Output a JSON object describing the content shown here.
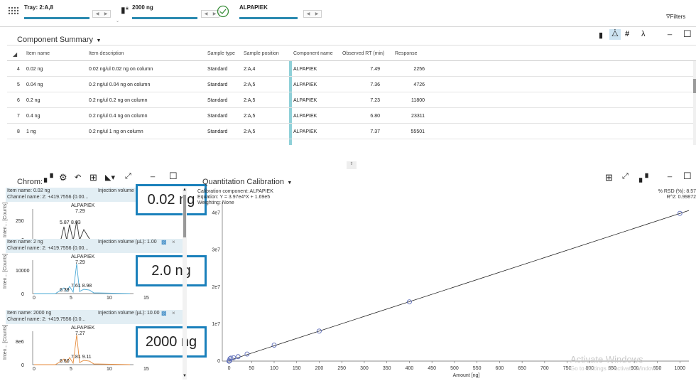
{
  "topbar": {
    "tray_label": "Tray: 2:A,8",
    "amount_label": "2000 ng",
    "component_label": "ALPAPIEK",
    "filters_label": "Filters"
  },
  "component_summary": {
    "title": "Component Summary",
    "columns": [
      "Item name",
      "Item description",
      "Sample type",
      "Sample position",
      "Component name",
      "Observed RT (min)",
      "Response"
    ],
    "rows": [
      {
        "idx": "4",
        "name": "0.02 ng",
        "desc": "0.02 ng/ul 0.02 ng on column",
        "type": "Standard",
        "pos": "2:A,4",
        "comp": "ALPAPIEK",
        "rt": "7.49",
        "resp": "2256"
      },
      {
        "idx": "5",
        "name": "0.04 ng",
        "desc": "0.2 ng/ul 0.04 ng on column",
        "type": "Standard",
        "pos": "2:A,5",
        "comp": "ALPAPIEK",
        "rt": "7.36",
        "resp": "4726"
      },
      {
        "idx": "6",
        "name": "0.2 ng",
        "desc": "0.2 ng/ul 0.2 ng on column",
        "type": "Standard",
        "pos": "2:A,5",
        "comp": "ALPAPIEK",
        "rt": "7.23",
        "resp": "11800"
      },
      {
        "idx": "7",
        "name": "0.4 ng",
        "desc": "0.2 ng/ul 0.4 ng on column",
        "type": "Standard",
        "pos": "2:A,5",
        "comp": "ALPAPIEK",
        "rt": "6.80",
        "resp": "23311"
      },
      {
        "idx": "8",
        "name": "1 ng",
        "desc": "0.2 ng/ul 1 ng on column",
        "type": "Standard",
        "pos": "2:A,5",
        "comp": "ALPAPIEK",
        "rt": "7.37",
        "resp": "55501"
      }
    ]
  },
  "chromatograms": {
    "title": "Chrom:",
    "ylabel": "Inten... [Counts]",
    "panels": [
      {
        "item": "Item name: 0.02 ng",
        "inj": "Injection volume (µL): 1.00",
        "channel": "Channel name: 2: +419.7556 (0.00...",
        "peak": "ALPAPIEK",
        "peak_rt": "7.29",
        "extra1": "5.87",
        "extra2": "8.03",
        "ytick": "250",
        "ytick0": "0",
        "xticks": [
          "0",
          "5",
          "10",
          "15"
        ],
        "badge": "0.02 ng",
        "color": "#333333"
      },
      {
        "item": "Item name: 2 ng",
        "inj": "Injection volume (µL): 1.00",
        "channel": "Channel name: 2: +419.7556 (0.00...",
        "peak": "ALPAPIEK",
        "peak_rt": "7.29",
        "extra1": "6.39",
        "extra2": "7.61 8.98",
        "ytick": "10000",
        "ytick0": "0",
        "xticks": [
          "0",
          "5",
          "10",
          "15"
        ],
        "badge": "2.0 ng",
        "color": "#4aa9d6"
      },
      {
        "item": "Item name: 2000 ng",
        "inj": "Injection volume (µL): 10.00",
        "channel": "Channel name: 2: +419.7556 (0.0...",
        "peak": "ALPAPIEK",
        "peak_rt": "7.27",
        "extra1": "6.60",
        "extra2": "7.81 9.11",
        "ytick": "8e6",
        "ytick0": "0",
        "xticks": [
          "0",
          "5",
          "10",
          "15"
        ],
        "badge": "2000 ng",
        "color": "#e58a3a"
      }
    ]
  },
  "calibration": {
    "title": "Quantitation Calibration",
    "component": "Calibration component: ALPAPIEK",
    "equation": "Equation: Y = 3.97e4*X + 1.69e5",
    "weighting": "Weighting: None",
    "rsd": "% RSD (%): 8.57",
    "r2": "R^2: 0.99872",
    "watermark": "Activate Windows",
    "watermark2": "Go to Settings to activate Windows."
  },
  "chart_data": {
    "type": "scatter",
    "xlabel": "Amount [ng]",
    "ylabel": "",
    "x_ticks": [
      0,
      50,
      100,
      150,
      200,
      250,
      300,
      350,
      400,
      450,
      500,
      550,
      600,
      650,
      700,
      750,
      800,
      850,
      900,
      950,
      1000
    ],
    "y_ticks": [
      "0",
      "1e7",
      "2e7",
      "3e7",
      "4e7"
    ],
    "xlim": [
      -15,
      1020
    ],
    "ylim": [
      0,
      43000000
    ],
    "points": [
      {
        "x": 0.02,
        "y": 2256
      },
      {
        "x": 0.04,
        "y": 4726
      },
      {
        "x": 0.2,
        "y": 11800
      },
      {
        "x": 0.4,
        "y": 23311
      },
      {
        "x": 1,
        "y": 55501
      },
      {
        "x": 2,
        "y": 600000
      },
      {
        "x": 4,
        "y": 800000
      },
      {
        "x": 10,
        "y": 900000
      },
      {
        "x": 20,
        "y": 1200000
      },
      {
        "x": 40,
        "y": 1900000
      },
      {
        "x": 100,
        "y": 4300000
      },
      {
        "x": 200,
        "y": 8100000
      },
      {
        "x": 400,
        "y": 16000000
      },
      {
        "x": 1000,
        "y": 39900000
      }
    ],
    "fit": {
      "slope": 39700,
      "intercept": 169000
    }
  }
}
